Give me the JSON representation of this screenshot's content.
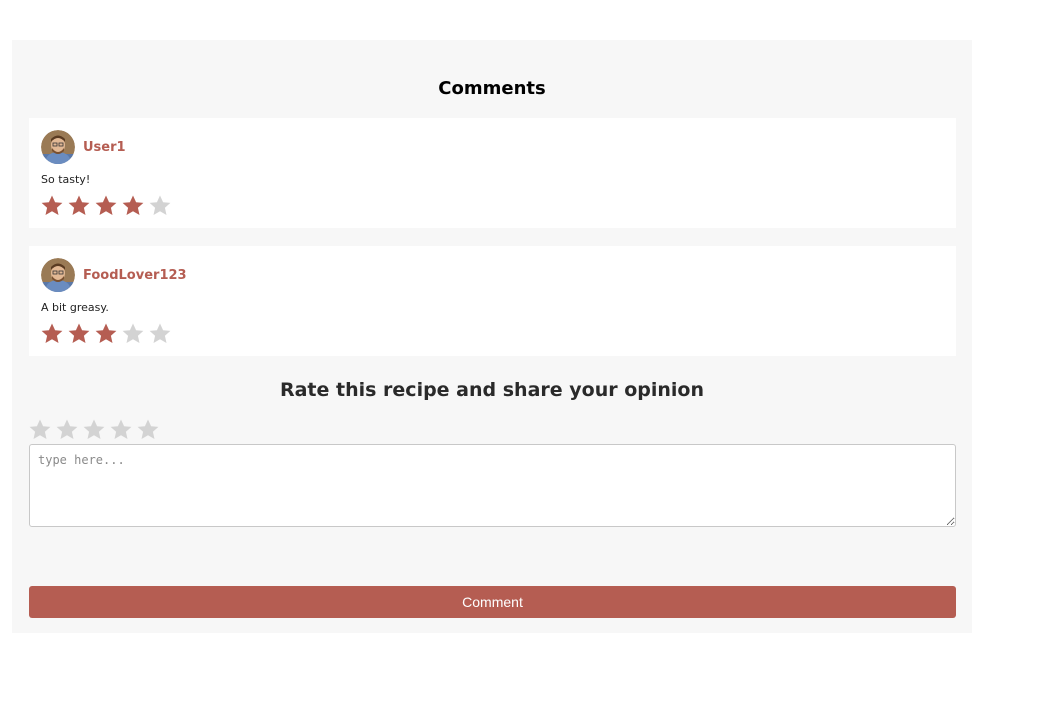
{
  "comments_section": {
    "title": "Comments",
    "items": [
      {
        "username": "User1",
        "text": "So tasty!",
        "rating": 4,
        "max_rating": 5,
        "avatar_icon": "user-avatar"
      },
      {
        "username": "FoodLover123",
        "text": "A bit greasy.",
        "rating": 3,
        "max_rating": 5,
        "avatar_icon": "user-avatar"
      }
    ]
  },
  "rate_section": {
    "title": "Rate this recipe and share your opinion",
    "rating": 0,
    "max_rating": 5,
    "textarea_value": "",
    "textarea_placeholder": "type here...",
    "submit_label": "Comment"
  },
  "colors": {
    "accent": "#b55d52",
    "star_empty": "#d3d3d3",
    "panel_background": "#f7f7f7"
  }
}
